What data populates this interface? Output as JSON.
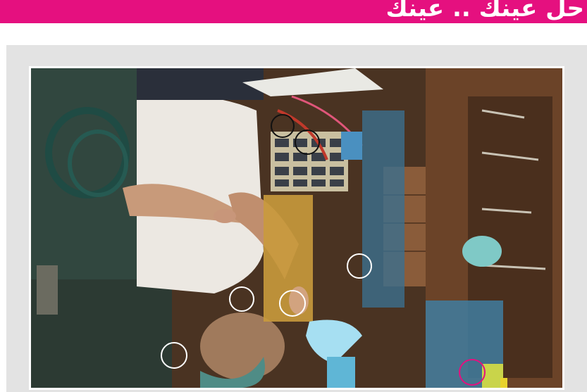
{
  "banner": {
    "title": "حل عينك .. عينك",
    "color": "#e5107f"
  },
  "game": {
    "type": "spot-the-difference",
    "marker_colors": {
      "found": "#ffffff",
      "dark": "#111111",
      "highlight": "#e5107f"
    },
    "markers": [
      {
        "id": 1,
        "style": "dark"
      },
      {
        "id": 2,
        "style": "dark"
      },
      {
        "id": 3,
        "style": "found"
      },
      {
        "id": 4,
        "style": "found"
      },
      {
        "id": 5,
        "style": "found"
      },
      {
        "id": 6,
        "style": "found"
      },
      {
        "id": 7,
        "style": "pink"
      }
    ]
  }
}
